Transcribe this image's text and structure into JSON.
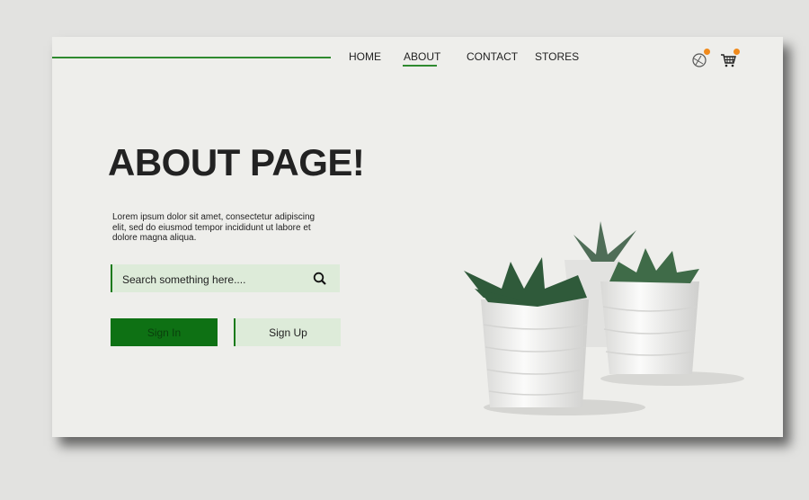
{
  "nav": {
    "items": [
      {
        "label": "HOME"
      },
      {
        "label": "ABOUT",
        "active": true
      },
      {
        "label": "CONTACT"
      },
      {
        "label": "STORES"
      }
    ]
  },
  "header_icons": [
    {
      "name": "globe-icon",
      "badge": true
    },
    {
      "name": "cart-icon",
      "badge": true
    }
  ],
  "hero": {
    "title": "ABOUT PAGE!",
    "description": "Lorem ipsum dolor sit amet, consectetur adipiscing elit, sed do eiusmod tempor incididunt ut labore et dolore magna aliqua.",
    "search": {
      "placeholder": "Search something here....",
      "value": ""
    },
    "sign_in": "Sign In",
    "sign_up": "Sign Up"
  },
  "colors": {
    "accent": "#0e7114",
    "light_green": "#ddebd9",
    "badge": "#f08a1c",
    "background": "#eeeeeb"
  }
}
